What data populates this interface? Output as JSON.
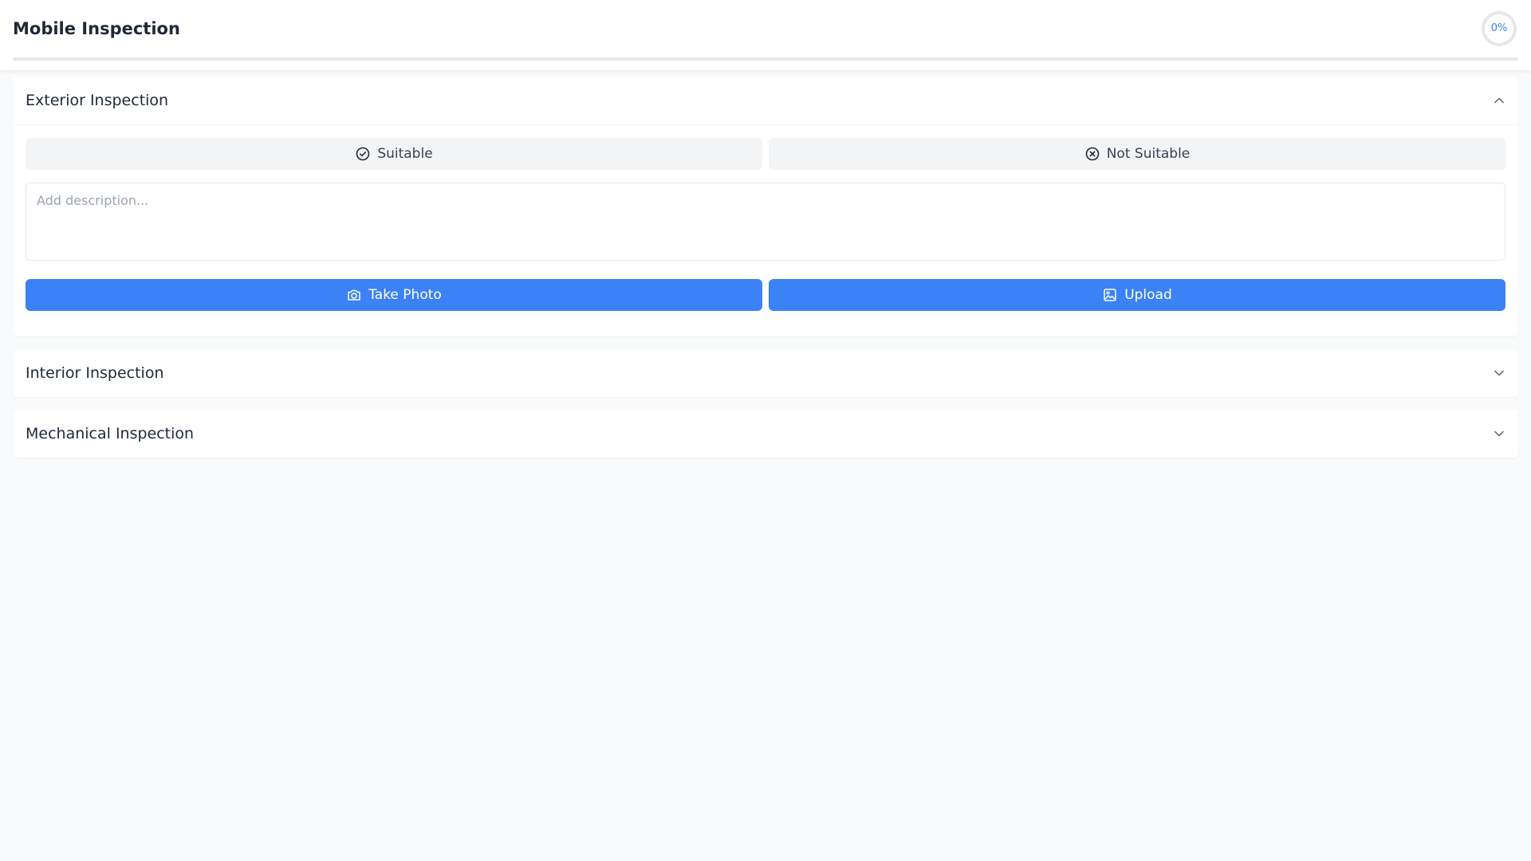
{
  "header": {
    "title": "Mobile Inspection",
    "progress_label": "0%",
    "progress_fraction": 0
  },
  "sections": [
    {
      "title": "Exterior Inspection",
      "expanded": true,
      "chevron": "chevron-up-icon",
      "suitable_label": "Suitable",
      "not_suitable_label": "Not Suitable",
      "description_value": "",
      "description_placeholder": "Add description...",
      "take_photo_label": "Take Photo",
      "upload_label": "Upload"
    },
    {
      "title": "Interior Inspection",
      "expanded": false,
      "chevron": "chevron-down-icon"
    },
    {
      "title": "Mechanical Inspection",
      "expanded": false,
      "chevron": "chevron-down-icon"
    }
  ],
  "colors": {
    "accent": "#3b82f6",
    "background": "#f9fafb",
    "surface": "#ffffff",
    "neutral_button": "#f3f4f6",
    "text": "#1f2937",
    "placeholder": "#9ca3af"
  },
  "icons": {
    "suitable": "check-circle-icon",
    "not_suitable": "x-circle-icon",
    "take_photo": "camera-icon",
    "upload": "image-icon"
  }
}
